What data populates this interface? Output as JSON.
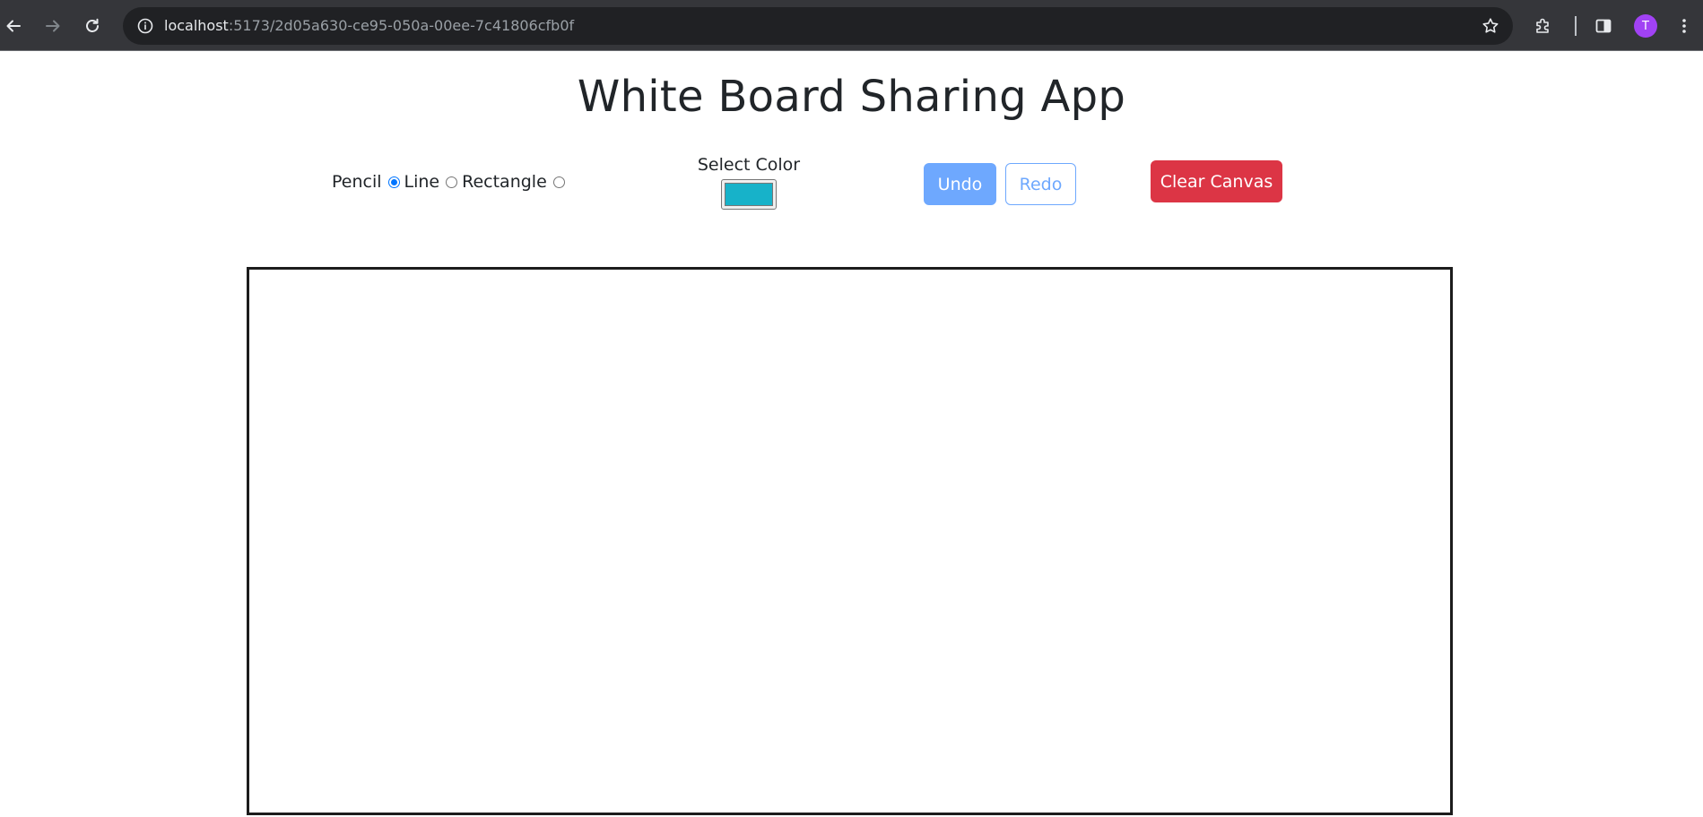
{
  "browser": {
    "url_host": "localhost",
    "url_rest": ":5173/2d05a630-ce95-050a-00ee-7c41806cfb0f",
    "profile_initial": "T",
    "icons": {
      "back": "arrow-left-icon",
      "forward": "arrow-right-icon",
      "reload": "reload-icon",
      "site_info": "info-icon",
      "bookmark": "star-icon",
      "extensions": "puzzle-icon",
      "side_panel": "side-panel-icon",
      "menu": "kebab-menu-icon"
    }
  },
  "page": {
    "title": "White Board Sharing App"
  },
  "toolbar": {
    "tools": [
      {
        "label": "Pencil",
        "checked": true
      },
      {
        "label": "Line",
        "checked": false
      },
      {
        "label": "Rectangle",
        "checked": false
      }
    ],
    "color_label": "Select Color",
    "color_value": "#17b2c9",
    "undo_label": "Undo",
    "redo_label": "Redo",
    "clear_label": "Clear Canvas"
  },
  "colors": {
    "primary_light": "#6ea8fe",
    "danger": "#dc3545",
    "text": "#212529",
    "chrome_bg": "#35363a",
    "omnibox_bg": "#202124",
    "avatar": "#a142f4"
  }
}
